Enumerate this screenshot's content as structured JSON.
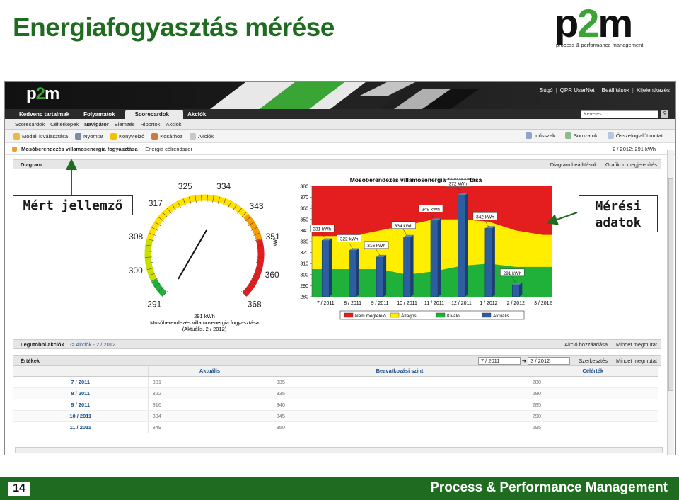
{
  "slide": {
    "title": "Energiafogyasztás mérése",
    "logo_main_a": "p",
    "logo_main_two": "2",
    "logo_main_b": "m",
    "logo_sub": "process & performance management",
    "page_number": "14",
    "footer_text": "Process & Performance Management"
  },
  "callouts": {
    "left": "Mért jellemző",
    "right_line1": "Mérési",
    "right_line2": "adatok"
  },
  "app": {
    "banner_links": [
      "Súgó",
      "QPR UserNet",
      "Beállítások",
      "Kijelentkezés"
    ],
    "main_tabs": [
      "Kedvenc tartalmak",
      "Folyamatok",
      "Scorecardok",
      "Akciók"
    ],
    "active_main_tab": "Scorecardok",
    "search_placeholder": "Keresés",
    "sub_tabs": [
      "Scorecardok",
      "Céltérképek",
      "Navigátor",
      "Elemzés",
      "Riportok",
      "Akciók"
    ],
    "toolbar": [
      "Modell kiválasztása",
      "Nyomtat",
      "Könyvjelző",
      "Kosárhoz",
      "Akciók"
    ],
    "toolbar_right": [
      "Idősszak",
      "Sorozatok",
      "Összefoglalót mutat"
    ],
    "breadcrumb_main": "Mosóberendezés villamosenergia fogyasztása",
    "breadcrumb_sub": "- Energia célrendszer",
    "period_label": "2 / 2012: 291 kWh",
    "diagram_title": "Diagram",
    "diagram_actions": [
      "Diagram beállítások",
      "Grafikon megjelenítés"
    ],
    "recent_actions_label": "Legutóbbi akciók",
    "recent_actions_link": "-> Akciók - 2 / 2012",
    "recent_actions_right": [
      "Akció hozzáadása",
      "Mindet megmutat"
    ],
    "values_label": "Értékek",
    "range_from": "7 / 2011",
    "range_to": "3 / 2012",
    "values_right": [
      "Szerkesztés",
      "Mindet megmutat"
    ],
    "table": {
      "headers": [
        "",
        "Aktuális",
        "Beavatkozási szint",
        "Célérték"
      ],
      "rows": [
        [
          "7 / 2011",
          "331",
          "335",
          "280"
        ],
        [
          "8 / 2011",
          "322",
          "335",
          "280"
        ],
        [
          "9 / 2011",
          "316",
          "340",
          "285"
        ],
        [
          "10 / 2011",
          "334",
          "345",
          "290"
        ],
        [
          "11 / 2011",
          "349",
          "350",
          "295"
        ]
      ]
    }
  },
  "gauge": {
    "value": 291,
    "min": 291,
    "max": 368,
    "ticks": [
      "291",
      "300",
      "308",
      "317",
      "325",
      "334",
      "343",
      "351",
      "360",
      "368"
    ],
    "caption_value": "291 kWh",
    "caption_title": "Mosóberendezés villamosenergia fogyasztása",
    "caption_period": "(Aktuális, 2 / 2012)"
  },
  "chart_data": {
    "type": "bar",
    "title": "Mosóberendezés villamosenergia fogyasztása",
    "ylabel": "kWh",
    "ylim": [
      280,
      380
    ],
    "yticks": [
      280,
      290,
      300,
      310,
      320,
      330,
      340,
      350,
      360,
      370,
      380
    ],
    "categories": [
      "7 / 2011",
      "8 / 2011",
      "9 / 2011",
      "10 / 2011",
      "11 / 2011",
      "12 / 2011",
      "1 / 2012",
      "2 / 2012",
      "3 / 2012"
    ],
    "series": [
      {
        "name": "Aktuális",
        "values": [
          331,
          322,
          316,
          334,
          349,
          372,
          342,
          291,
          null
        ]
      }
    ],
    "data_labels": [
      "331 kWh",
      "322 kWh",
      "316 kWh",
      "334 kWh",
      "349 kWh",
      "372 kWh",
      "342 kWh",
      "291 kWh",
      ""
    ],
    "bands": {
      "green_top": [
        305,
        305,
        305,
        300,
        303,
        308,
        310,
        307,
        307
      ],
      "yellow_top": [
        335,
        335,
        340,
        345,
        350,
        350,
        348,
        340,
        336
      ]
    },
    "legend": [
      "Nem megfelelő",
      "Átlagos",
      "Kiváló",
      "Aktuális"
    ],
    "colors": {
      "red": "#e41e1e",
      "yellow": "#ffee00",
      "green": "#1fb13a",
      "bar": "#2d5fa0"
    }
  }
}
